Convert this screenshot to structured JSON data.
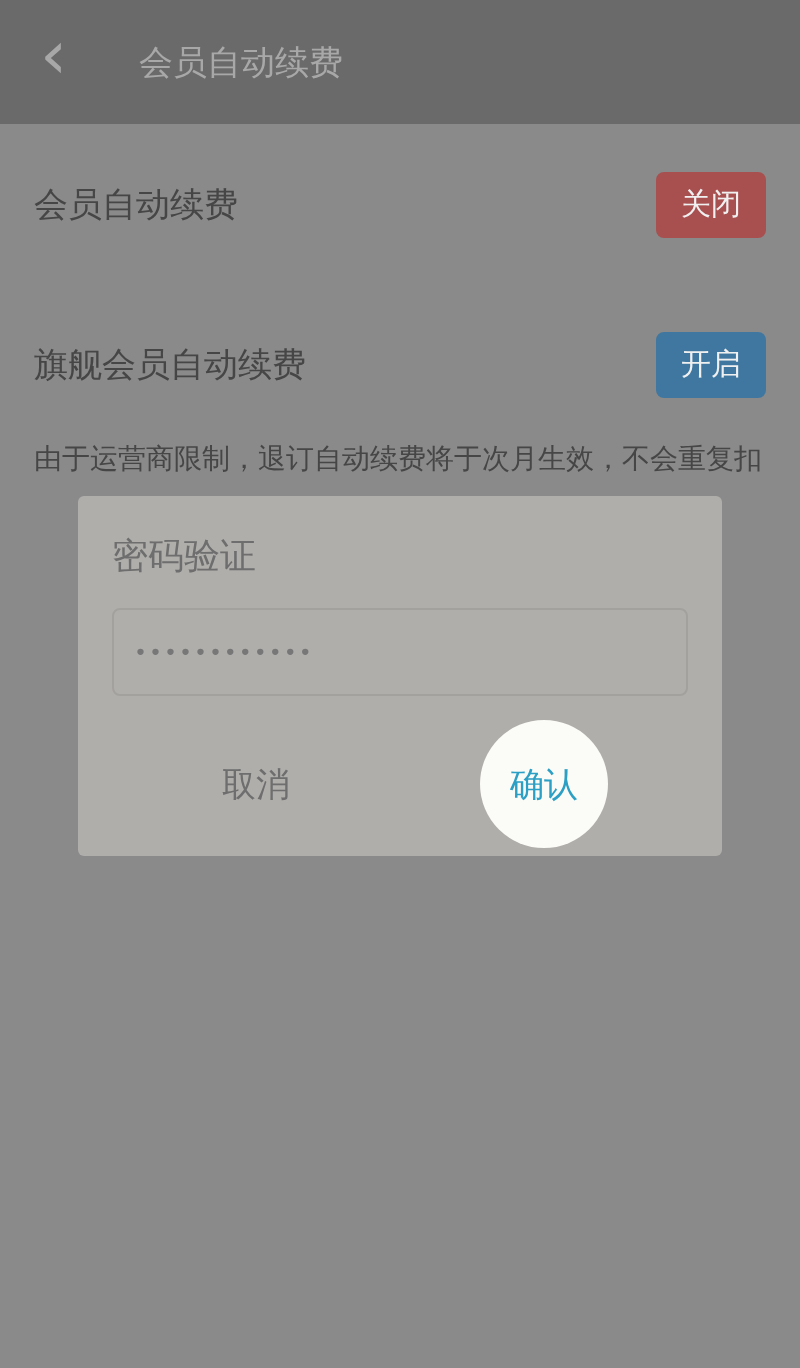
{
  "header": {
    "back": "‹",
    "title": "会员自动续费"
  },
  "settings": [
    {
      "label": "会员自动续费",
      "button": "关闭",
      "on": true
    },
    {
      "label": "旗舰会员自动续费",
      "button": "开启",
      "on": false
    }
  ],
  "note": "由于运营商限制，退订自动续费将于次月生效，不会重复扣",
  "dialog": {
    "title": "密码验证",
    "password": "••••••••••••",
    "buttons": [
      {
        "label": "取消",
        "highlighted": false
      },
      {
        "label": "确认",
        "highlighted": true
      }
    ]
  }
}
